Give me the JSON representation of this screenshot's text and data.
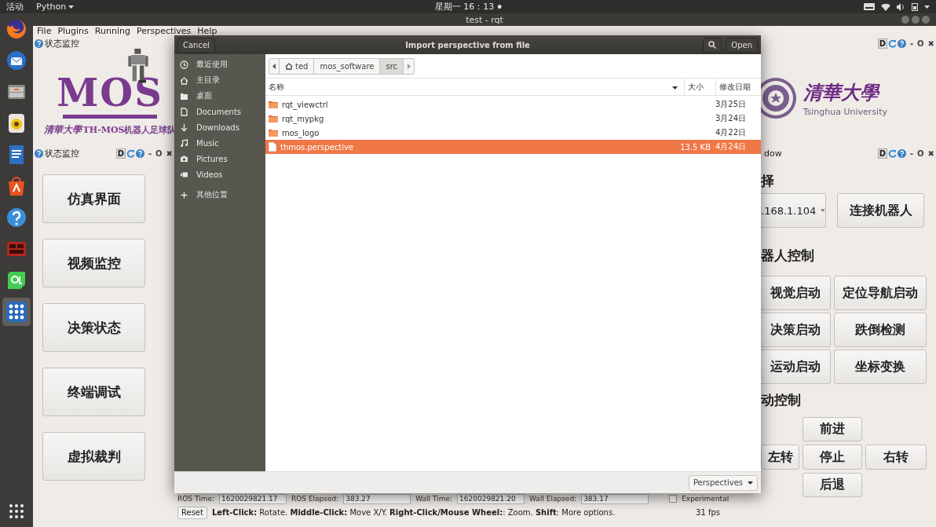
{
  "top_bar": {
    "activities": "活动",
    "app_menu": "Python",
    "clock": "星期一 16：13"
  },
  "launcher": [
    {
      "kind": "firefox",
      "selected": false
    },
    {
      "kind": "mail",
      "selected": false
    },
    {
      "kind": "files",
      "selected": false
    },
    {
      "kind": "speaker",
      "selected": false
    },
    {
      "kind": "writer",
      "selected": false
    },
    {
      "kind": "store",
      "selected": false
    },
    {
      "kind": "help",
      "selected": false
    },
    {
      "kind": "panel",
      "selected": false
    },
    {
      "kind": "qt",
      "selected": false
    },
    {
      "kind": "dots",
      "selected": true
    }
  ],
  "window": {
    "title": "test - rqt"
  },
  "menu": [
    "File",
    "Plugins",
    "Running",
    "Perspectives",
    "Help"
  ],
  "top_dock": {
    "title": "状态监控",
    "controls": [
      {
        "kind": "boxed",
        "label": "D"
      },
      {
        "kind": "reload"
      },
      {
        "kind": "help"
      },
      {
        "kind": "plain",
        "label": "-"
      },
      {
        "kind": "plain",
        "label": "O"
      },
      {
        "kind": "plain",
        "label": "✖"
      }
    ]
  },
  "logos": {
    "mos": {
      "wordmark": "MOS",
      "script": "清華大學",
      "caption": "TH-MOS机器人足球队"
    },
    "tsinghua": {
      "script": "清華大學",
      "name": "Tsinghua University"
    }
  },
  "left_dock": {
    "title": "状态监控",
    "controls": [
      {
        "kind": "boxed",
        "label": "D"
      },
      {
        "kind": "reload"
      },
      {
        "kind": "help"
      },
      {
        "kind": "plain",
        "label": "-"
      },
      {
        "kind": "plain",
        "label": "O"
      },
      {
        "kind": "plain",
        "label": "✖"
      }
    ],
    "buttons": [
      "仿真界面",
      "视频监控",
      "决策状态",
      "终端调试",
      "虚拟裁判"
    ]
  },
  "right_dock": {
    "title": "dow",
    "controls": [
      {
        "kind": "boxed",
        "label": "D"
      },
      {
        "kind": "reload"
      },
      {
        "kind": "help"
      },
      {
        "kind": "plain",
        "label": "-"
      },
      {
        "kind": "plain",
        "label": "O"
      },
      {
        "kind": "plain",
        "label": "✖"
      }
    ],
    "connect_heading": "择",
    "robot_combo": ".168.1.104",
    "connect_button": "连接机器人",
    "control_heading": "器人控制",
    "control_buttons": [
      "视觉启动",
      "定位导航启动",
      "决策启动",
      "跌倒检测",
      "运动启动",
      "坐标变换"
    ],
    "motion_heading": "动控制",
    "motion_buttons": [
      {
        "label": "前进",
        "kind": "up"
      },
      {
        "label": "左转",
        "kind": "left"
      },
      {
        "label": "停止",
        "kind": "center"
      },
      {
        "label": "右转",
        "kind": "right"
      },
      {
        "label": "后退",
        "kind": "down"
      }
    ]
  },
  "status": {
    "fields": [
      {
        "label": "ROS Time:",
        "value": "1620029821.17"
      },
      {
        "label": "ROS Elapsed:",
        "value": "383.27"
      },
      {
        "label": "Wall Time:",
        "value": "1620029821.20"
      },
      {
        "label": "Wall Elapsed:",
        "value": "383.17"
      }
    ],
    "experimental": {
      "label": "Experimental",
      "checked": false
    },
    "reset": "Reset",
    "hint": "**Left-Click:** Rotate. **Middle-Click:** Move X/Y. **Right-Click/Mouse Wheel:**: Zoom. **Shift**: More options.",
    "fps": "31 fps"
  },
  "dialog": {
    "title": "Import perspective from file",
    "cancel": "Cancel",
    "open": "Open",
    "places": [
      {
        "kind": "recent",
        "label": "最近使用"
      },
      {
        "kind": "home",
        "label": "主目录"
      },
      {
        "kind": "folder",
        "label": "桌面"
      },
      {
        "kind": "document",
        "label": "Documents"
      },
      {
        "kind": "download",
        "label": "Downloads"
      },
      {
        "kind": "music",
        "label": "Music"
      },
      {
        "kind": "camera",
        "label": "Pictures"
      },
      {
        "kind": "video",
        "label": "Videos"
      },
      {
        "kind": "add",
        "label": "其他位置"
      }
    ],
    "path": [
      {
        "label": "ted",
        "kind": "home",
        "selected": false
      },
      {
        "label": "mos_software",
        "kind": "plain",
        "selected": false
      },
      {
        "label": "src",
        "kind": "plain",
        "selected": true
      }
    ],
    "columns": [
      "名称",
      "大小",
      "修改日期"
    ],
    "files": [
      {
        "kind": "folder",
        "name": "rqt_viewctrl",
        "modified": "3月25日",
        "selected": false
      },
      {
        "kind": "folder",
        "name": "rqt_mypkg",
        "modified": "3月24日",
        "selected": false
      },
      {
        "kind": "folder",
        "name": "mos_logo",
        "modified": "4月22日",
        "selected": false
      },
      {
        "kind": "file",
        "name": "thmos.perspective",
        "size": "13.5 KB",
        "modified": "4月24日",
        "selected": true
      }
    ],
    "filter": "Perspectives"
  }
}
